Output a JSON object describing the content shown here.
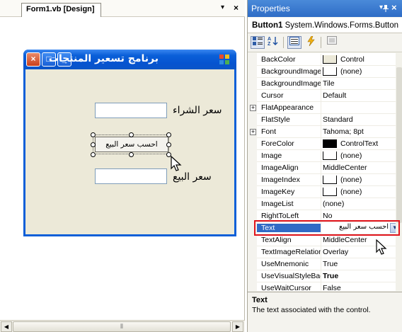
{
  "designer": {
    "tab_label": "Form1.vb [Design]",
    "dropdown_glyph": "▾",
    "close_glyph": "×"
  },
  "form": {
    "title": "برنامج تسعير المنتجات",
    "purchase_label": "سعر الشراء",
    "sale_label": "سعر البيع",
    "button_text": "احسب سعر البيع",
    "min_glyph": "_",
    "max_glyph": "□",
    "close_glyph": "×"
  },
  "properties": {
    "title": "Properties",
    "pin_glyph": "ᵖ",
    "dropdown_glyph": "▾",
    "close_glyph": "×",
    "object_name": "Button1",
    "object_type": "System.Windows.Forms.Button",
    "rows": [
      {
        "name": "BackColor",
        "value": "Control",
        "swatch": "#ece9d8"
      },
      {
        "name": "BackgroundImage",
        "value": "(none)",
        "swatch": "#ffffff"
      },
      {
        "name": "BackgroundImageLayout",
        "value": "Tile"
      },
      {
        "name": "Cursor",
        "value": "Default"
      },
      {
        "name": "FlatAppearance",
        "value": "",
        "expander": true
      },
      {
        "name": "FlatStyle",
        "value": "Standard"
      },
      {
        "name": "Font",
        "value": "Tahoma; 8pt",
        "expander": true
      },
      {
        "name": "ForeColor",
        "value": "ControlText",
        "swatch": "#000000"
      },
      {
        "name": "Image",
        "value": "(none)",
        "swatch": "#ffffff"
      },
      {
        "name": "ImageAlign",
        "value": "MiddleCenter"
      },
      {
        "name": "ImageIndex",
        "value": "(none)",
        "swatch": "#ffffff"
      },
      {
        "name": "ImageKey",
        "value": "(none)",
        "swatch": "#ffffff"
      },
      {
        "name": "ImageList",
        "value": "(none)"
      },
      {
        "name": "RightToLeft",
        "value": "No"
      },
      {
        "name": "Text",
        "value": "احسب سعر البيع",
        "selected": true
      },
      {
        "name": "TextAlign",
        "value": "MiddleCenter"
      },
      {
        "name": "TextImageRelation",
        "value": "Overlay"
      },
      {
        "name": "UseMnemonic",
        "value": "True"
      },
      {
        "name": "UseVisualStyleBackColor",
        "value": "True",
        "bold": true
      },
      {
        "name": "UseWaitCursor",
        "value": "False"
      }
    ],
    "description_title": "Text",
    "description_text": "The text associated with the control."
  },
  "colors": {
    "highlight": "#e0141c",
    "selection": "#316ac5",
    "titlebar": "#0a5fd8"
  }
}
